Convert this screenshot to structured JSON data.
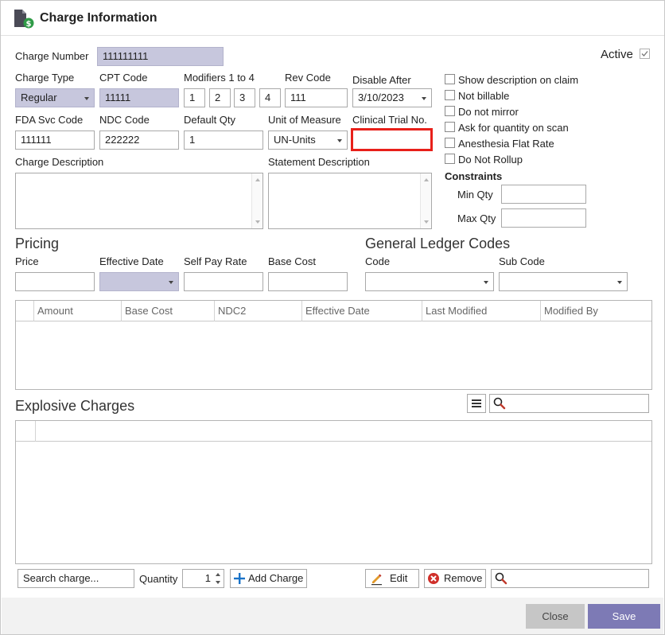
{
  "window": {
    "title": "Charge Information",
    "icon": "document-dollar-icon"
  },
  "charge_number": {
    "label": "Charge Number",
    "value": "111111111"
  },
  "active": {
    "label": "Active",
    "checked": true
  },
  "charge_type": {
    "label": "Charge Type",
    "value": "Regular"
  },
  "cpt_code": {
    "label": "CPT Code",
    "value": "11111"
  },
  "modifiers": {
    "label": "Modifiers 1 to 4",
    "values": [
      "1",
      "2",
      "3",
      "4"
    ]
  },
  "rev_code": {
    "label": "Rev Code",
    "value": "111"
  },
  "disable_after": {
    "label": "Disable After",
    "value": "3/10/2023"
  },
  "fda_svc_code": {
    "label": "FDA Svc Code",
    "value": "111111"
  },
  "ndc_code": {
    "label": "NDC Code",
    "value": "222222"
  },
  "default_qty": {
    "label": "Default Qty",
    "value": "1"
  },
  "unit_of_measure": {
    "label": "Unit of Measure",
    "value": "UN-Units"
  },
  "clinical_trial": {
    "label": "Clinical Trial No.",
    "value": "",
    "highlight_color": "#e8201a"
  },
  "charge_description": {
    "label": "Charge Description"
  },
  "statement_description": {
    "label": "Statement Description"
  },
  "options": [
    {
      "label": "Show description on claim",
      "checked": false
    },
    {
      "label": "Not billable",
      "checked": false
    },
    {
      "label": "Do not mirror",
      "checked": false
    },
    {
      "label": "Ask for quantity on scan",
      "checked": false
    },
    {
      "label": "Anesthesia Flat Rate",
      "checked": false
    },
    {
      "label": "Do Not Rollup",
      "checked": false
    }
  ],
  "constraints": {
    "title": "Constraints",
    "min_qty_label": "Min Qty",
    "max_qty_label": "Max Qty"
  },
  "pricing": {
    "title": "Pricing",
    "price_label": "Price",
    "effective_date_label": "Effective Date",
    "self_pay_rate_label": "Self Pay Rate",
    "base_cost_label": "Base Cost"
  },
  "gl_codes": {
    "title": "General Ledger Codes",
    "code_label": "Code",
    "sub_code_label": "Sub Code"
  },
  "pricing_grid": {
    "columns": [
      "Amount",
      "Base Cost",
      "NDC2",
      "Effective Date",
      "Last Modified",
      "Modified By"
    ]
  },
  "explosive": {
    "title": "Explosive Charges"
  },
  "toolbar": {
    "search_placeholder": "Search charge...",
    "quantity_label": "Quantity",
    "quantity_value": "1",
    "add_label": "Add Charge",
    "edit_label": "Edit",
    "remove_label": "Remove"
  },
  "footer": {
    "close_label": "Close",
    "save_label": "Save"
  },
  "colors": {
    "readonly_bg": "#c7c7dd",
    "save_bg": "#7d7ab5",
    "close_bg": "#c6c6c6",
    "add_icon": "#1a73c8",
    "remove_icon": "#d0302a"
  }
}
